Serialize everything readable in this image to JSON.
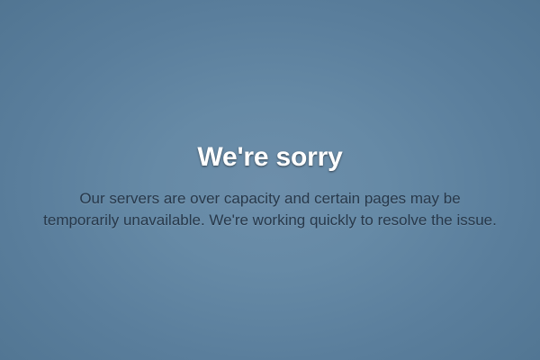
{
  "error_page": {
    "title": "We're sorry",
    "message_lines": [
      "Our servers are over capacity and certain pages may be",
      "temporarily unavailable. We're working quickly to resolve the issue."
    ]
  },
  "colors": {
    "background_center": "#6d8eaa",
    "background_edge": "#517592",
    "title_text": "#ffffff",
    "message_text": "#27384a"
  }
}
